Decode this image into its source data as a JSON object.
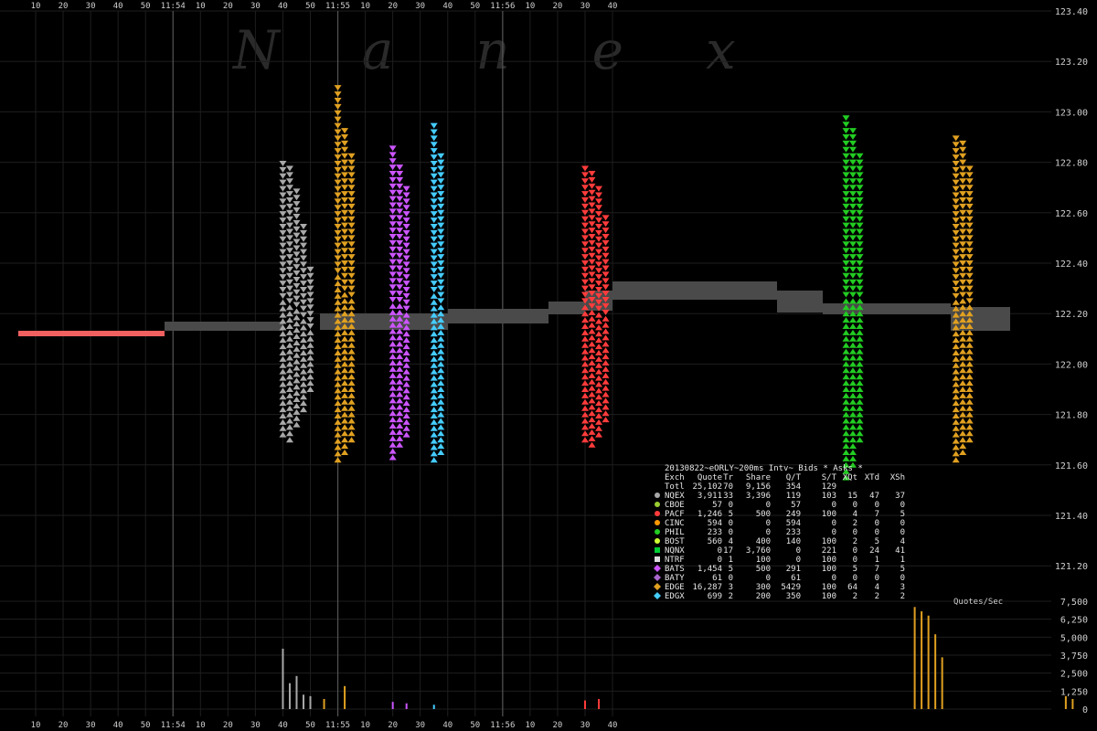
{
  "watermark": "Nanex",
  "chart_data": {
    "type": "scatter",
    "title": "20130822~eORLY~200ms Intv~ Bids * Asks *",
    "x_axis": {
      "tick_labels": [
        "10",
        "20",
        "30",
        "40",
        "50",
        "11:54",
        "10",
        "20",
        "30",
        "40",
        "50",
        "11:55",
        "10",
        "20",
        "30",
        "40",
        "50",
        "11:56",
        "10",
        "20",
        "30",
        "40"
      ],
      "minute_labels": [
        "11:54",
        "11:55",
        "11:56"
      ]
    },
    "y_axis": {
      "ylim": [
        121.0,
        123.4
      ],
      "tick_labels": [
        "123.40",
        "123.20",
        "123.00",
        "122.80",
        "122.60",
        "122.40",
        "122.20",
        "122.00",
        "121.80",
        "121.60",
        "121.40",
        "121.20"
      ]
    },
    "volume_axis": {
      "label": "Quotes/Sec",
      "ylim": [
        0,
        7500
      ],
      "tick_labels": [
        "7,500",
        "6,250",
        "5,000",
        "3,750",
        "2,500",
        "1,250",
        "0"
      ]
    },
    "stats_table": {
      "header": [
        "Exch",
        "Quote",
        "Tr",
        "Share",
        "Q/T",
        "S/T",
        "XQt",
        "XTd",
        "XSh"
      ],
      "total": [
        "Totl",
        "25,102",
        "70",
        "9,156",
        "354",
        "129",
        "",
        "",
        ""
      ],
      "rows": [
        {
          "exch": "NQEX",
          "color": "#a8a8a8",
          "marker": "circle",
          "values": [
            "3,911",
            "33",
            "3,396",
            "119",
            "103",
            "15",
            "47",
            "37"
          ]
        },
        {
          "exch": "CBOE",
          "color": "#9acd32",
          "marker": "circle",
          "values": [
            "57",
            "0",
            "0",
            "57",
            "0",
            "0",
            "0",
            "0"
          ]
        },
        {
          "exch": "PACF",
          "color": "#ff3b3b",
          "marker": "circle",
          "values": [
            "1,246",
            "5",
            "500",
            "249",
            "100",
            "4",
            "7",
            "5"
          ]
        },
        {
          "exch": "CINC",
          "color": "#ff9900",
          "marker": "circle",
          "values": [
            "594",
            "0",
            "0",
            "594",
            "0",
            "2",
            "0",
            "0"
          ]
        },
        {
          "exch": "PHIL",
          "color": "#22cc22",
          "marker": "circle",
          "values": [
            "233",
            "0",
            "0",
            "233",
            "0",
            "0",
            "0",
            "0"
          ]
        },
        {
          "exch": "BOST",
          "color": "#ccff33",
          "marker": "circle",
          "values": [
            "560",
            "4",
            "400",
            "140",
            "100",
            "2",
            "5",
            "4"
          ]
        },
        {
          "exch": "NQNX",
          "color": "#00cc33",
          "marker": "square",
          "values": [
            "0",
            "17",
            "3,760",
            "0",
            "221",
            "0",
            "24",
            "41"
          ]
        },
        {
          "exch": "NTRF",
          "color": "#dddddd",
          "marker": "square",
          "values": [
            "0",
            "1",
            "100",
            "0",
            "100",
            "0",
            "1",
            "1"
          ]
        },
        {
          "exch": "BATS",
          "color": "#cc55ff",
          "marker": "diamond",
          "values": [
            "1,454",
            "5",
            "500",
            "291",
            "100",
            "5",
            "7",
            "5"
          ]
        },
        {
          "exch": "BATY",
          "color": "#aa66cc",
          "marker": "diamond",
          "values": [
            "61",
            "0",
            "0",
            "61",
            "0",
            "0",
            "0",
            "0"
          ]
        },
        {
          "exch": "EDGE",
          "color": "#e0a020",
          "marker": "diamond",
          "values": [
            "16,287",
            "3",
            "300",
            "5429",
            "100",
            "64",
            "4",
            "3"
          ]
        },
        {
          "exch": "EDGX",
          "color": "#44ccff",
          "marker": "diamond",
          "values": [
            "699",
            "2",
            "200",
            "350",
            "100",
            "2",
            "2",
            "2"
          ]
        }
      ]
    },
    "series": [
      {
        "exch": "NQEX",
        "color": "#a8a8a8",
        "x": [
          19,
          19.5,
          20,
          20.5,
          21
        ],
        "low": [
          121.72,
          121.7,
          121.76,
          121.82,
          121.9
        ],
        "high": [
          122.8,
          122.78,
          122.7,
          122.55,
          122.4
        ]
      },
      {
        "exch": "EDGE",
        "color": "#e0a020",
        "x": [
          23,
          23.5,
          24
        ],
        "low": [
          121.62,
          121.65,
          121.7
        ],
        "high": [
          123.1,
          122.95,
          122.85
        ]
      },
      {
        "exch": "BATS",
        "color": "#cc55ff",
        "x": [
          27,
          27.5,
          28
        ],
        "low": [
          121.63,
          121.68,
          121.72
        ],
        "high": [
          122.86,
          122.8,
          122.7
        ]
      },
      {
        "exch": "EDGX",
        "color": "#44ccff",
        "x": [
          30,
          30.5
        ],
        "low": [
          121.62,
          121.65
        ],
        "high": [
          122.95,
          122.85
        ]
      },
      {
        "exch": "PACF",
        "color": "#ff3b3b",
        "x": [
          41,
          41.5,
          42,
          42.5
        ],
        "low": [
          121.7,
          121.68,
          121.72,
          121.78
        ],
        "high": [
          122.8,
          122.78,
          122.7,
          122.6
        ]
      },
      {
        "exch": "PHIL",
        "color": "#22cc22",
        "x": [
          60,
          60.5,
          61
        ],
        "low": [
          121.55,
          121.6,
          121.7
        ],
        "high": [
          123.0,
          122.95,
          122.85
        ]
      },
      {
        "exch": "EDGE",
        "color": "#e0a020",
        "x": [
          68,
          68.5,
          69
        ],
        "low": [
          121.62,
          121.65,
          121.7
        ],
        "high": [
          122.92,
          122.88,
          122.8
        ]
      }
    ],
    "volume": {
      "x": [
        19,
        19.5,
        20,
        20.5,
        21,
        22,
        23.5,
        27,
        28,
        30,
        41,
        42,
        65,
        65.5,
        66,
        66.5,
        67,
        76,
        76.5
      ],
      "values": [
        4200,
        1800,
        2300,
        1000,
        900,
        700,
        1600,
        500,
        400,
        300,
        600,
        700,
        7100,
        6800,
        6500,
        5200,
        3600,
        900,
        700
      ]
    }
  }
}
